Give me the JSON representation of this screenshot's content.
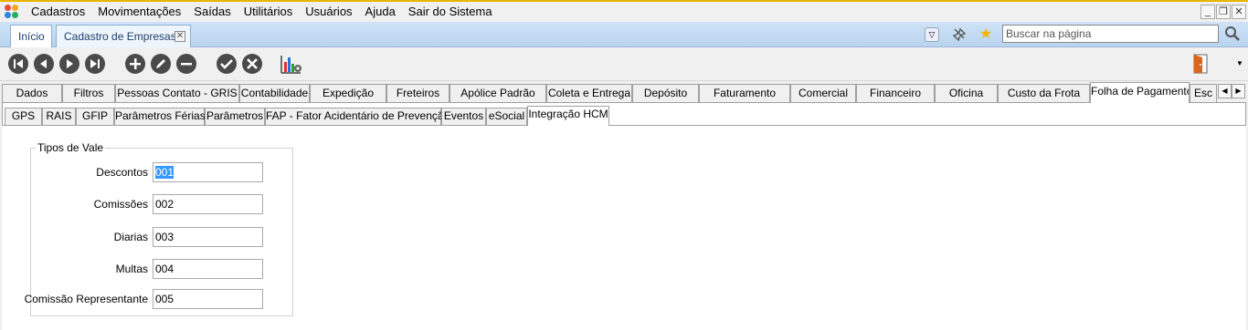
{
  "menu": {
    "items": [
      {
        "label": "Cadastros",
        "ul": "C"
      },
      {
        "label": "Movimentações",
        "ul": "M"
      },
      {
        "label": "Saídas",
        "ul": "S"
      },
      {
        "label": "Utilitários",
        "ul": "U"
      },
      {
        "label": "Usuários",
        "ul": ""
      },
      {
        "label": "Ajuda",
        "ul": "A"
      },
      {
        "label": "Sair do Sistema",
        "ul": ""
      }
    ]
  },
  "doc_tabs": {
    "home_label": "Início",
    "active_label": "Cadastro de Empresas"
  },
  "search": {
    "placeholder": "Buscar na página"
  },
  "main_tabs": [
    "Dados",
    "Filtros",
    "Pessoas Contato - GRIS",
    "Contabilidade",
    "Expedição",
    "Freteiros",
    "Apólice Padrão",
    "Coleta e Entrega",
    "Depósito",
    "Faturamento",
    "Comercial",
    "Financeiro",
    "Oficina",
    "Custo da Frota",
    "Folha de Pagamento",
    "Esc"
  ],
  "main_tabs_active": "Folha de Pagamento",
  "sub_tabs": [
    "GPS",
    "RAIS",
    "GFIP",
    "Parâmetros Férias",
    "Parâmetros",
    "FAP - Fator Acidentário de Prevenção",
    "Eventos",
    "eSocial",
    "Integração HCM"
  ],
  "sub_tabs_active": "Integração HCM",
  "group": {
    "title": "Tipos de Vale",
    "fields": [
      {
        "label": "Descontos",
        "value": "001",
        "selected": true
      },
      {
        "label": "Comissões",
        "value": "002",
        "selected": false
      },
      {
        "label": "Diarias",
        "value": "003",
        "selected": false
      },
      {
        "label": "Multas",
        "value": "004",
        "selected": false
      },
      {
        "label": "Comissão Representante",
        "value": "005",
        "selected": false
      }
    ]
  },
  "colors": {
    "accent_bar": "#e7b400",
    "tab_strip": "#c4dbf3",
    "toolbar_button": "#4a4a4a",
    "selection": "#3399ff"
  }
}
